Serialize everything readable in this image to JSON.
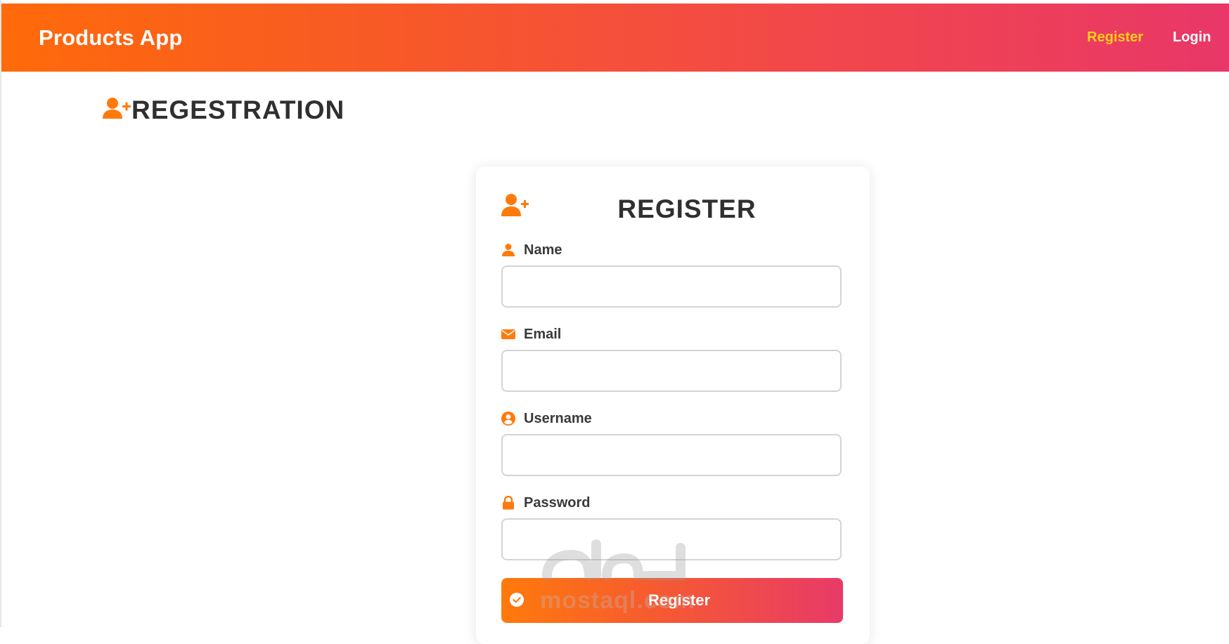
{
  "app": {
    "brand": "Products App"
  },
  "nav": {
    "register_label": "Register",
    "login_label": "Login"
  },
  "page": {
    "heading": "REGESTRATION"
  },
  "form": {
    "title": "REGISTER",
    "fields": [
      {
        "label": "Name",
        "icon": "user-icon",
        "value": "",
        "placeholder": ""
      },
      {
        "label": "Email",
        "icon": "envelope-icon",
        "value": "",
        "placeholder": ""
      },
      {
        "label": "Username",
        "icon": "user-circle-icon",
        "value": "",
        "placeholder": ""
      },
      {
        "label": "Password",
        "icon": "lock-icon",
        "value": "",
        "placeholder": ""
      }
    ],
    "submit_label": "Register",
    "submit_icon": "check-circle-icon"
  },
  "watermark": {
    "text": "mostaql.com"
  },
  "colors": {
    "accent": "#ff7a0c",
    "gradient_start": "#ff6a0a",
    "gradient_end": "#e83768",
    "nav_active": "#ffd11a",
    "heading_text": "#2f2f2f"
  }
}
